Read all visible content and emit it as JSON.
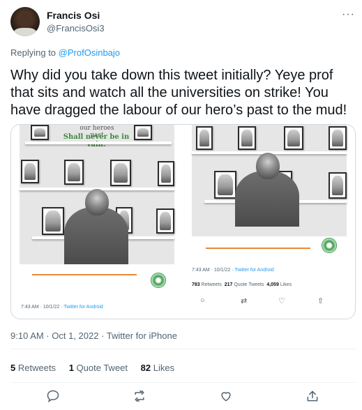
{
  "author": {
    "name": "Francis Osi",
    "handle": "@FrancisOsi3"
  },
  "reply": {
    "prefix": "Replying to",
    "to": "@ProfOsinbajo"
  },
  "tweet": {
    "text": "Why did you take down this tweet initially? Yeye prof that sits and watch all the universities on strike! You have dragged the labour of our hero’s past to the mud!"
  },
  "media": {
    "left": {
      "heading_line1": "our heroes past",
      "heading_line2": "Shall never be in vain.",
      "meta_time": "7:43 AM · 10/1/22 · ",
      "meta_source": "Twitter for Android"
    },
    "right": {
      "meta_time": "7:43 AM · 10/1/22 · ",
      "meta_source": "Twitter for Android",
      "retweets_count": "783",
      "retweets_label": "Retweets",
      "quotes_count": "217",
      "quotes_label": "Quote Tweets",
      "likes_count": "4,059",
      "likes_label": "Likes"
    }
  },
  "meta": {
    "timestamp": "9:10 AM · Oct 1, 2022 · Twitter for iPhone"
  },
  "stats": {
    "retweets_count": "5",
    "retweets_label": "Retweets",
    "quotes_count": "1",
    "quotes_label": "Quote Tweet",
    "likes_count": "82",
    "likes_label": "Likes"
  },
  "colors": {
    "link": "#1d9bf0",
    "secondary": "#536471",
    "primary": "#0f1419"
  },
  "icons": {
    "more": "more-icon",
    "reply": "reply-icon",
    "retweet": "retweet-icon",
    "like": "like-icon",
    "share": "share-icon"
  }
}
